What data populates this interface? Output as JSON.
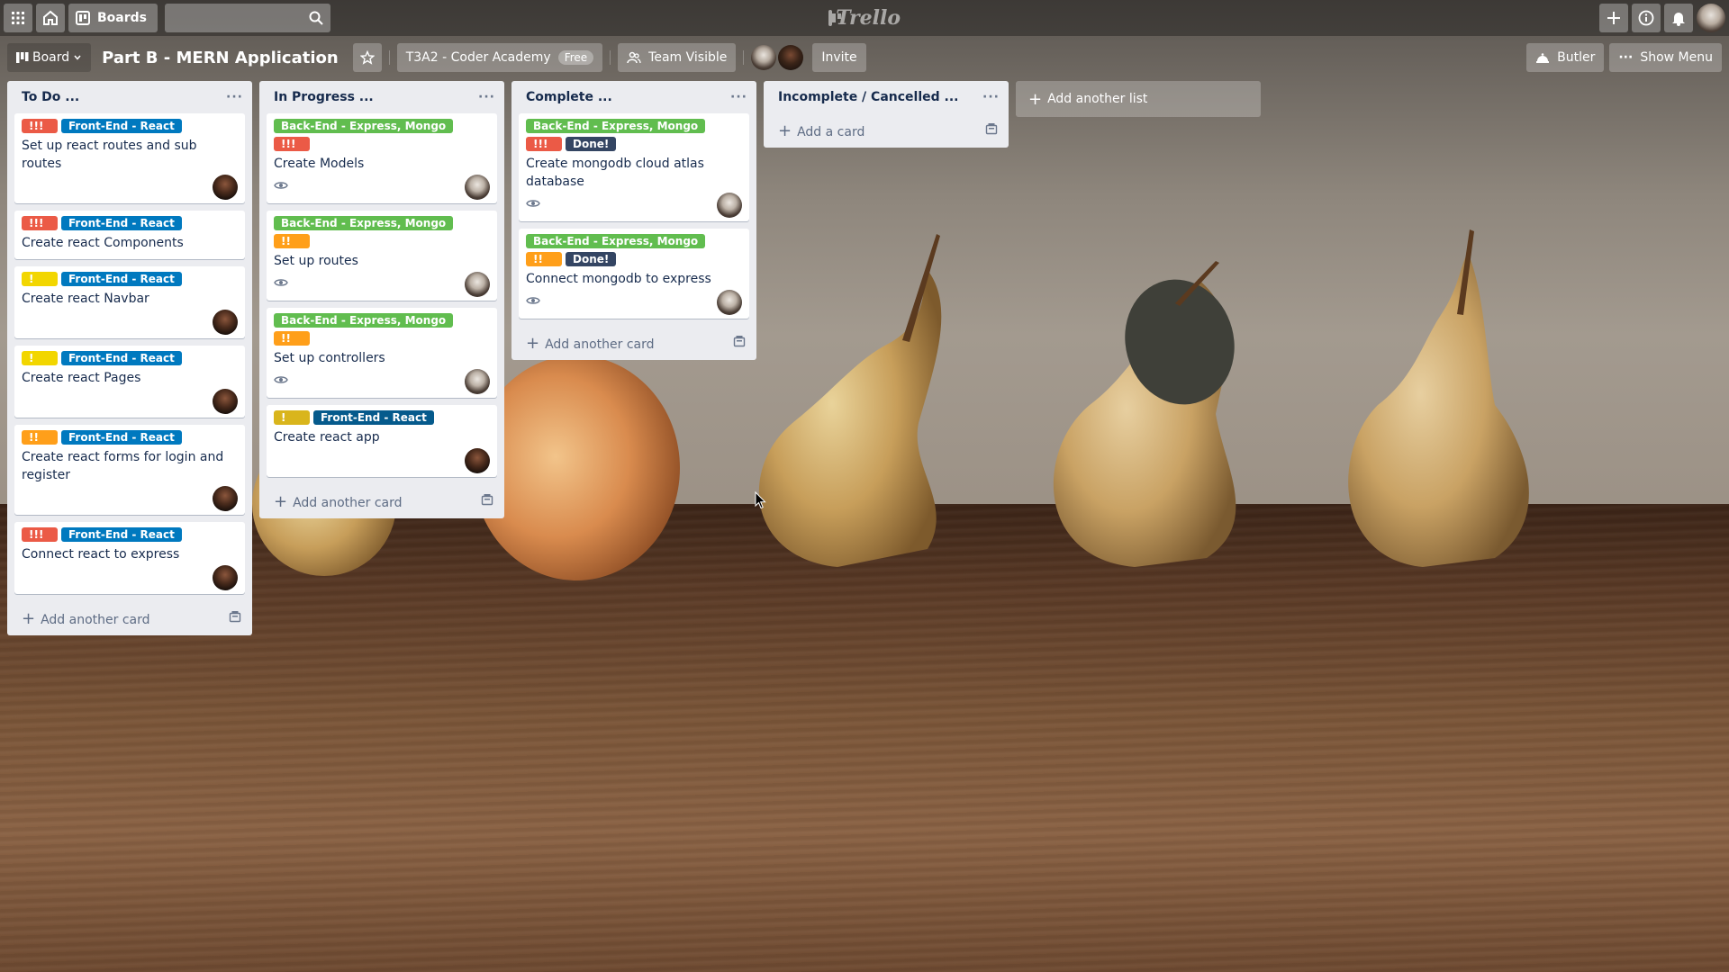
{
  "header": {
    "boards_label": "Boards",
    "logo_text": "Trello"
  },
  "board": {
    "view_label": "Board",
    "title": "Part B - MERN Application",
    "team_name": "T3A2 - Coder Academy",
    "team_badge": "Free",
    "visibility_label": "Team Visible",
    "invite_label": "Invite",
    "butler_label": "Butler",
    "show_menu_label": "Show Menu"
  },
  "colors": {
    "red": "#eb5a46",
    "orange": "#ff9f1a",
    "yellow": "#f2d600",
    "mustard": "#d9b51c",
    "blue": "#0079bf",
    "darkblue": "#055a8c",
    "green": "#61bd4f",
    "navy": "#344563"
  },
  "lists": [
    {
      "title": "To Do ...",
      "footer": "Add another card",
      "cards": [
        {
          "labels": [
            {
              "text": "!!!",
              "color": "red"
            },
            {
              "text": "Front-End - React",
              "color": "blue"
            }
          ],
          "title": "Set up react routes and sub routes",
          "watch": false,
          "avatar": "dark"
        },
        {
          "labels": [
            {
              "text": "!!!",
              "color": "red"
            },
            {
              "text": "Front-End - React",
              "color": "blue"
            }
          ],
          "title": "Create react Components",
          "watch": false,
          "avatar": ""
        },
        {
          "labels": [
            {
              "text": "!",
              "color": "yellow"
            },
            {
              "text": "Front-End - React",
              "color": "blue"
            }
          ],
          "title": "Create react Navbar",
          "watch": false,
          "avatar": "dark"
        },
        {
          "labels": [
            {
              "text": "!",
              "color": "yellow"
            },
            {
              "text": "Front-End - React",
              "color": "blue"
            }
          ],
          "title": "Create react Pages",
          "watch": false,
          "avatar": "dark"
        },
        {
          "labels": [
            {
              "text": "!!",
              "color": "orange"
            },
            {
              "text": "Front-End - React",
              "color": "blue"
            }
          ],
          "title": "Create react forms for login and register",
          "watch": false,
          "avatar": "dark"
        },
        {
          "labels": [
            {
              "text": "!!!",
              "color": "red"
            },
            {
              "text": "Front-End - React",
              "color": "blue"
            }
          ],
          "title": "Connect react to express",
          "watch": false,
          "avatar": "dark"
        }
      ]
    },
    {
      "title": "In Progress ...",
      "footer": "Add another card",
      "cards": [
        {
          "labels": [
            {
              "text": "Back-End - Express, Mongo",
              "color": "green"
            },
            {
              "text": "!!!",
              "color": "red"
            }
          ],
          "title": "Create Models",
          "watch": true,
          "avatar": "light"
        },
        {
          "labels": [
            {
              "text": "Back-End - Express, Mongo",
              "color": "green"
            },
            {
              "text": "!!",
              "color": "orange"
            }
          ],
          "title": "Set up routes",
          "watch": true,
          "avatar": "light"
        },
        {
          "labels": [
            {
              "text": "Back-End - Express, Mongo",
              "color": "green"
            },
            {
              "text": "!!",
              "color": "orange"
            }
          ],
          "title": "Set up controllers",
          "watch": true,
          "avatar": "light"
        },
        {
          "labels": [
            {
              "text": "!",
              "color": "mustard"
            },
            {
              "text": "Front-End - React",
              "color": "darkblue"
            }
          ],
          "title": "Create react app",
          "watch": false,
          "avatar": "dark"
        }
      ]
    },
    {
      "title": "Complete ...",
      "footer": "Add another card",
      "cards": [
        {
          "labels": [
            {
              "text": "Back-End - Express, Mongo",
              "color": "green"
            },
            {
              "text": "!!!",
              "color": "red"
            },
            {
              "text": "Done!",
              "color": "navy"
            }
          ],
          "title": "Create mongodb cloud atlas database",
          "watch": true,
          "avatar": "light"
        },
        {
          "labels": [
            {
              "text": "Back-End - Express, Mongo",
              "color": "green"
            },
            {
              "text": "!!",
              "color": "orange"
            },
            {
              "text": "Done!",
              "color": "navy"
            }
          ],
          "title": "Connect mongodb to express",
          "watch": true,
          "avatar": "light"
        }
      ]
    },
    {
      "title": "Incomplete / Cancelled ...",
      "footer": "Add a card",
      "cards": []
    }
  ],
  "add_list_label": "Add another list"
}
